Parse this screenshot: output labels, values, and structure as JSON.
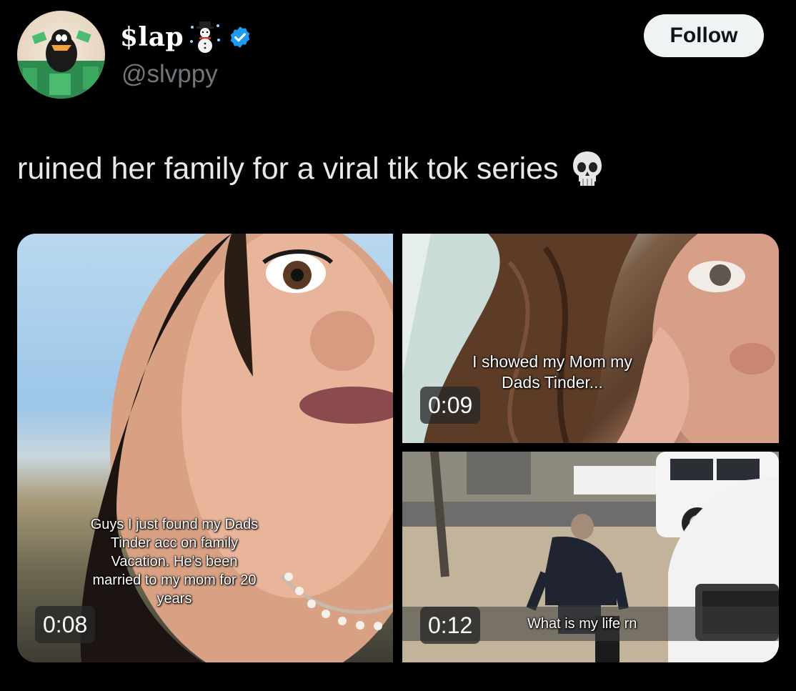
{
  "profile": {
    "display_name": "$lap",
    "handle": "@slvppy",
    "avatar_icon": "avatar-cartoon-duck",
    "snowman_icon": "snowman-emoji",
    "verified_icon": "verified-badge-icon",
    "verified_color": "#1d9bf0"
  },
  "follow_button": {
    "label": "Follow"
  },
  "tweet": {
    "text": "ruined her family for a viral tik tok series",
    "emoji_icon": "skull-emoji"
  },
  "media": {
    "videos": [
      {
        "duration": "0:08",
        "caption_lines": [
          "Guys I just found my Dads",
          "Tinder acc on family",
          "Vacation. He's been",
          "married to my mom for 20",
          "years"
        ]
      },
      {
        "duration": "0:09",
        "caption_lines": [
          "I showed my Mom my",
          "Dads Tinder..."
        ]
      },
      {
        "duration": "0:12",
        "caption": "What is my life rn"
      }
    ]
  }
}
